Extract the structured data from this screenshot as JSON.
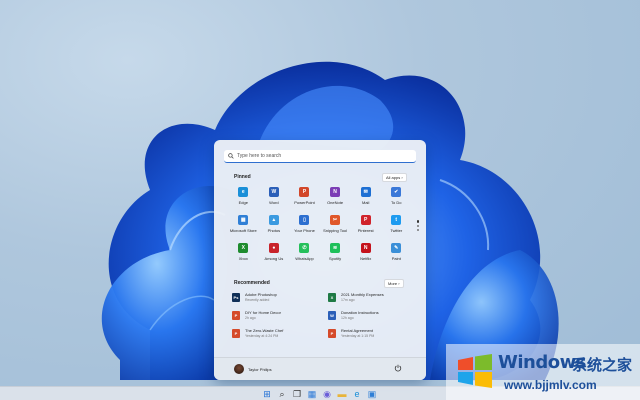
{
  "search": {
    "placeholder": "Type here to search"
  },
  "pinned": {
    "title": "Pinned",
    "all_apps_label": "All apps  ›",
    "apps": [
      {
        "label": "Edge",
        "icon": "edge-icon",
        "color": "#1a8fd8",
        "glyph": "e"
      },
      {
        "label": "Word",
        "icon": "word-icon",
        "color": "#2b5fb8",
        "glyph": "W"
      },
      {
        "label": "PowerPoint",
        "icon": "powerpoint-icon",
        "color": "#d2472a",
        "glyph": "P"
      },
      {
        "label": "OneNote",
        "icon": "onenote-icon",
        "color": "#7b3db5",
        "glyph": "N"
      },
      {
        "label": "Mail",
        "icon": "mail-icon",
        "color": "#1d6fd3",
        "glyph": "✉"
      },
      {
        "label": "To Do",
        "icon": "todo-icon",
        "color": "#3a78d8",
        "glyph": "✔"
      },
      {
        "label": "Microsoft Store",
        "icon": "store-icon",
        "color": "#2f7fd6",
        "glyph": "▦"
      },
      {
        "label": "Photos",
        "icon": "photos-icon",
        "color": "#3b9ae0",
        "glyph": "▲"
      },
      {
        "label": "Your Phone",
        "icon": "phone-icon",
        "color": "#2c6fd0",
        "glyph": "▯"
      },
      {
        "label": "Snipping Tool",
        "icon": "snipping-tool-icon",
        "color": "#e0572a",
        "glyph": "✂"
      },
      {
        "label": "Pinterest",
        "icon": "pinterest-icon",
        "color": "#d0232b",
        "glyph": "P"
      },
      {
        "label": "Twitter",
        "icon": "twitter-icon",
        "color": "#1d9bf0",
        "glyph": "t"
      },
      {
        "label": "Xbox",
        "icon": "xbox-icon",
        "color": "#1e8b2e",
        "glyph": "X"
      },
      {
        "label": "Among Us",
        "icon": "among-us-icon",
        "color": "#c8232b",
        "glyph": "●"
      },
      {
        "label": "WhatsApp",
        "icon": "whatsapp-icon",
        "color": "#25c05b",
        "glyph": "✆"
      },
      {
        "label": "Spotify",
        "icon": "spotify-icon",
        "color": "#1ec05a",
        "glyph": "≋"
      },
      {
        "label": "Netflix",
        "icon": "netflix-icon",
        "color": "#c4121c",
        "glyph": "N"
      },
      {
        "label": "Paint",
        "icon": "paint-icon",
        "color": "#3b8fd8",
        "glyph": "✎"
      }
    ]
  },
  "recommended": {
    "title": "Recommended",
    "more_label": "More  ›",
    "items": [
      {
        "name": "Adobe Photoshop",
        "time": "Recently added",
        "icon": "photoshop-icon",
        "color": "#0f2f57",
        "glyph": "Ps"
      },
      {
        "name": "2021 Monthly Expenses",
        "time": "17m ago",
        "icon": "excel-file-icon",
        "color": "#1f7a45",
        "glyph": "X"
      },
      {
        "name": "DIY for Home Decor",
        "time": "2h ago",
        "icon": "pdf-file-icon",
        "color": "#d54a2a",
        "glyph": "P"
      },
      {
        "name": "Donation Instructions",
        "time": "12h ago",
        "icon": "word-file-icon",
        "color": "#2b5fb8",
        "glyph": "W"
      },
      {
        "name": "The Zero-Waste Chef",
        "time": "Yesterday at 4:24 PM",
        "icon": "pdf-file-icon",
        "color": "#d54a2a",
        "glyph": "P"
      },
      {
        "name": "Rental Agreement",
        "time": "Yesterday at 1:15 PM",
        "icon": "pdf-file-icon",
        "color": "#d54a2a",
        "glyph": "P"
      }
    ]
  },
  "user": {
    "name": "Taylor Philips"
  },
  "taskbar": {
    "icons": [
      {
        "icon": "start-icon",
        "glyph": "⊞",
        "color": "#1f6fd6"
      },
      {
        "icon": "search-icon",
        "glyph": "⌕",
        "color": "#333"
      },
      {
        "icon": "task-view-icon",
        "glyph": "❐",
        "color": "#333"
      },
      {
        "icon": "widgets-icon",
        "glyph": "▦",
        "color": "#2d7ad8"
      },
      {
        "icon": "chat-icon",
        "glyph": "◉",
        "color": "#6b5ed8"
      },
      {
        "icon": "file-explorer-icon",
        "glyph": "▬",
        "color": "#e8b43a"
      },
      {
        "icon": "edge-icon",
        "glyph": "e",
        "color": "#1a8fd8"
      },
      {
        "icon": "store-icon",
        "glyph": "▣",
        "color": "#2f7fd6"
      }
    ]
  },
  "watermark": {
    "brand": "Windows",
    "chinese": "系统之家",
    "url": "www.bjjmlv.com"
  }
}
